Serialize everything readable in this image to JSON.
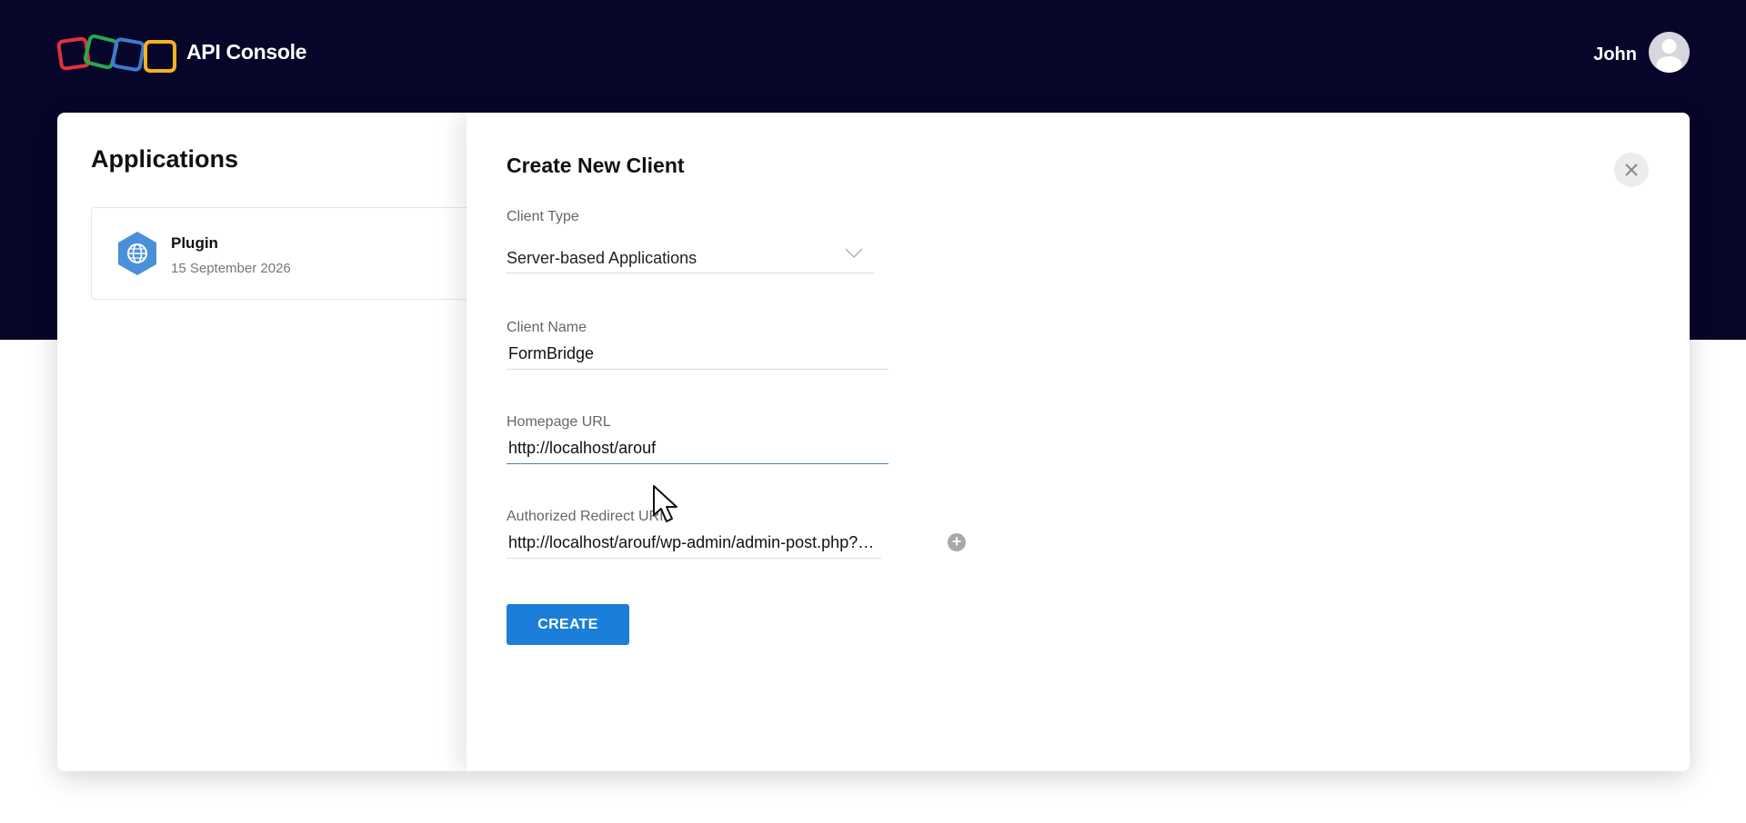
{
  "header": {
    "app_title": "API Console",
    "user_name": "John",
    "logo_colors": [
      "#e0313f",
      "#2aa84a",
      "#3e7bcc",
      "#f6b21a"
    ]
  },
  "applications": {
    "heading": "Applications",
    "items": [
      {
        "name": "Plugin",
        "date": "15 September 2026",
        "icon": "globe-icon"
      }
    ]
  },
  "create_client": {
    "title": "Create New Client",
    "client_type": {
      "label": "Client Type",
      "value": "Server-based Applications"
    },
    "client_name": {
      "label": "Client Name",
      "value": "FormBridge"
    },
    "homepage_url": {
      "label": "Homepage URL",
      "value": "http://localhost/arouf"
    },
    "redirect_uris": {
      "label": "Authorized Redirect URIs",
      "value": "http://localhost/arouf/wp-admin/admin-post.php?action=formbridge"
    },
    "add_label": "+",
    "create_label": "CREATE"
  },
  "colors": {
    "header_bg": "#07062a",
    "primary_button": "#1b7fd9"
  }
}
